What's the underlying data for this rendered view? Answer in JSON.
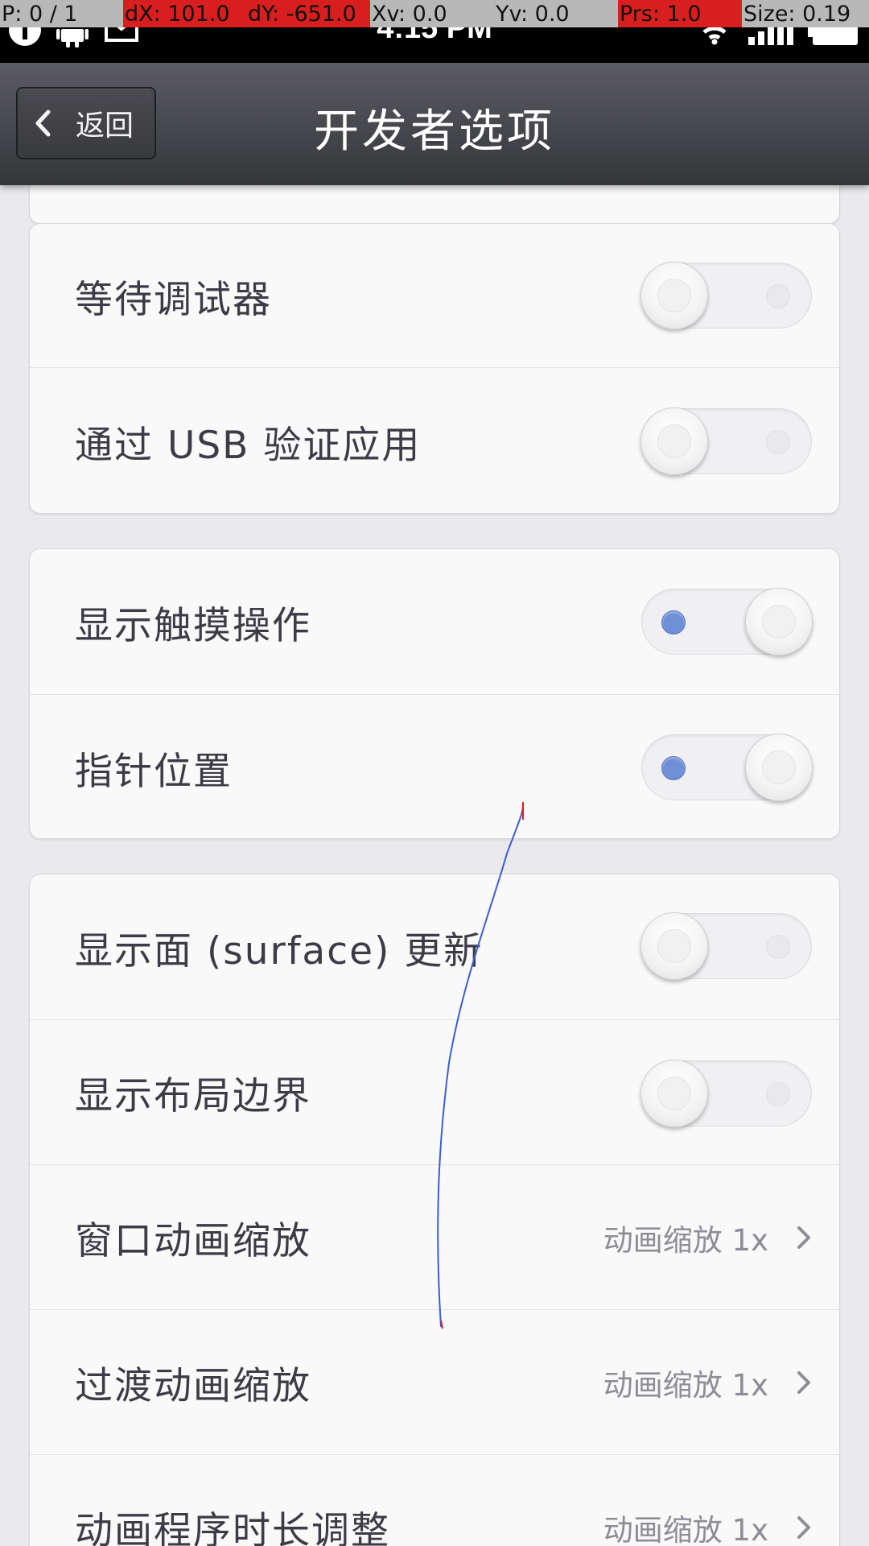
{
  "pointer_overlay": {
    "cells": [
      "P: 0 / 1",
      "dX: 101.0",
      "dY: -651.0",
      "Xv: 0.0",
      "Yv: 0.0",
      "Prs: 1.0",
      "Size: 0.19"
    ]
  },
  "statusbar": {
    "time": "4:15 PM",
    "icons": [
      "alert-icon",
      "android-icon",
      "mail-icon",
      "wifi-icon",
      "signal-icon",
      "battery-icon"
    ]
  },
  "header": {
    "back_label": "返回",
    "title": "开发者选项"
  },
  "groups": [
    {
      "rows": [
        {
          "label": "等待调试器",
          "toggle": false
        },
        {
          "label": "通过 USB 验证应用",
          "toggle": false
        }
      ]
    },
    {
      "rows": [
        {
          "label": "显示触摸操作",
          "toggle": true
        },
        {
          "label": "指针位置",
          "toggle": true
        }
      ]
    },
    {
      "rows": [
        {
          "label": "显示面 (surface) 更新",
          "toggle": false
        },
        {
          "label": "显示布局边界",
          "toggle": false
        },
        {
          "label": "窗口动画缩放",
          "value": "动画缩放 1x"
        },
        {
          "label": "过渡动画缩放",
          "value": "动画缩放 1x"
        },
        {
          "label": "动画程序时长调整",
          "value": "动画缩放 1x"
        }
      ]
    }
  ],
  "colors": {
    "accent_dot": "#6f8fd6",
    "trace_line": "#3a5fd0",
    "overlay_highlight": "#d81e1e"
  }
}
